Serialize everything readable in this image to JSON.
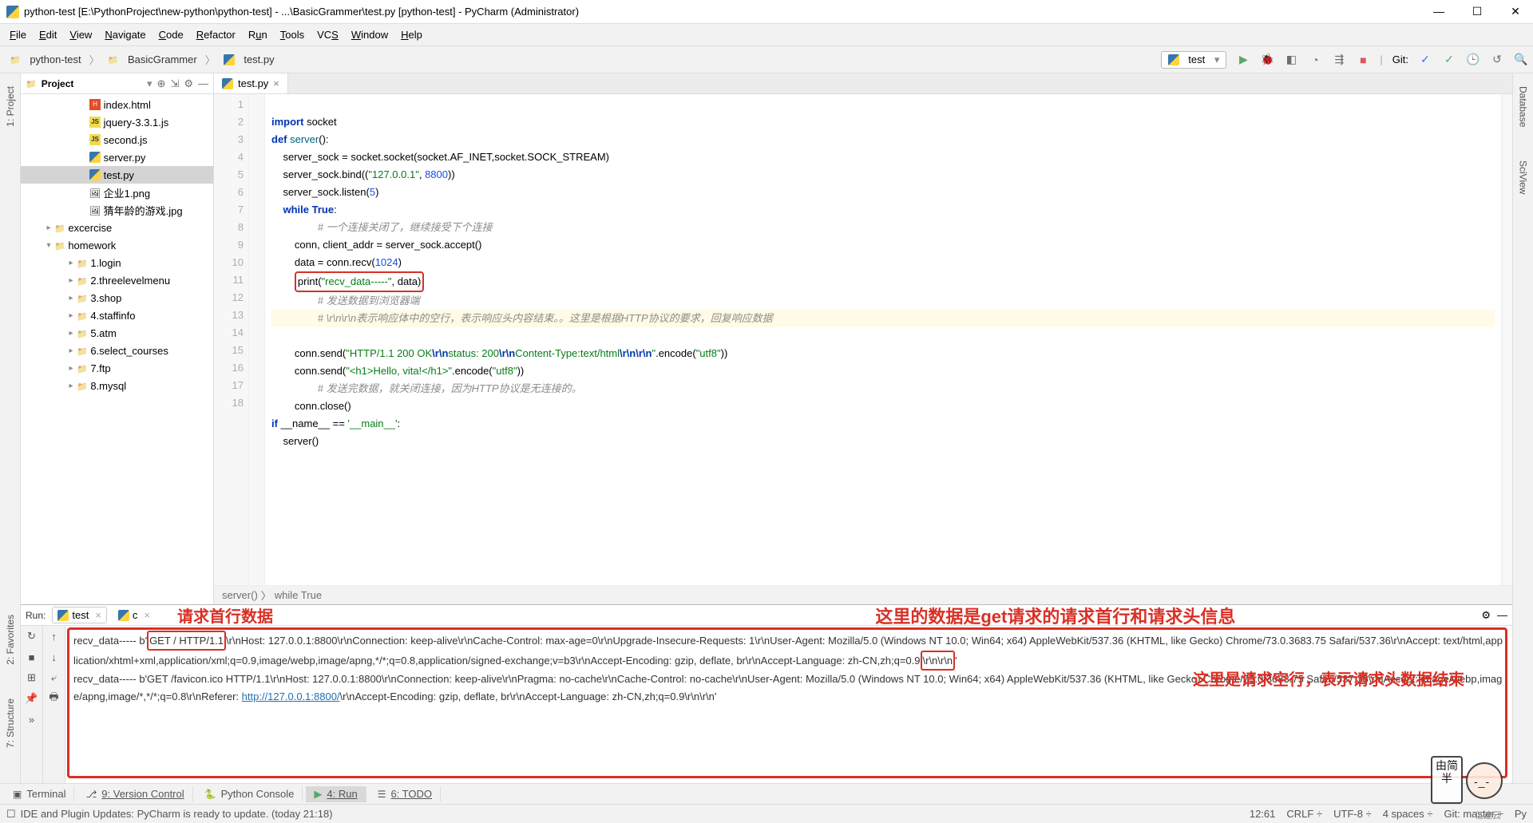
{
  "window": {
    "title": "python-test [E:\\PythonProject\\new-python\\python-test] - ...\\BasicGrammer\\test.py [python-test] - PyCharm (Administrator)"
  },
  "menu": [
    "File",
    "Edit",
    "View",
    "Navigate",
    "Code",
    "Refactor",
    "Run",
    "Tools",
    "VCS",
    "Window",
    "Help"
  ],
  "breadcrumb": {
    "items": [
      "python-test",
      "BasicGrammer",
      "test.py"
    ]
  },
  "run_config": {
    "name": "test"
  },
  "git_label": "Git:",
  "project": {
    "title": "Project",
    "files_flat": [
      {
        "name": "index.html",
        "type": "html",
        "indent": 72
      },
      {
        "name": "jquery-3.3.1.js",
        "type": "js",
        "indent": 72
      },
      {
        "name": "second.js",
        "type": "js",
        "indent": 72
      },
      {
        "name": "server.py",
        "type": "py",
        "indent": 72
      },
      {
        "name": "test.py",
        "type": "py",
        "indent": 72,
        "sel": true
      },
      {
        "name": "企业1.png",
        "type": "img",
        "indent": 72
      },
      {
        "name": "猜年龄的游戏.jpg",
        "type": "img",
        "indent": 72
      }
    ],
    "folders": [
      {
        "name": "excercise",
        "exp": "▸",
        "indent": 28
      },
      {
        "name": "homework",
        "exp": "▾",
        "indent": 28
      },
      {
        "name": "1.login",
        "exp": "▸",
        "indent": 56
      },
      {
        "name": "2.threelevelmenu",
        "exp": "▸",
        "indent": 56
      },
      {
        "name": "3.shop",
        "exp": "▸",
        "indent": 56
      },
      {
        "name": "4.staffinfo",
        "exp": "▸",
        "indent": 56
      },
      {
        "name": "5.atm",
        "exp": "▸",
        "indent": 56
      },
      {
        "name": "6.select_courses",
        "exp": "▸",
        "indent": 56
      },
      {
        "name": "7.ftp",
        "exp": "▸",
        "indent": 56
      },
      {
        "name": "8.mysql",
        "exp": "▸",
        "indent": 56
      }
    ]
  },
  "tab": {
    "name": "test.py"
  },
  "code": {
    "line_count": 18,
    "lines": {
      "l1": "import socket",
      "l2": "def server():",
      "l3": "    server_sock = socket.socket(socket.AF_INET,socket.SOCK_STREAM)",
      "l4_a": "    server_sock.bind((",
      "l4_ip": "\"127.0.0.1\"",
      "l4_b": ", ",
      "l4_port": "8800",
      "l4_c": "))",
      "l5_a": "    server_sock.listen(",
      "l5_n": "5",
      "l5_b": ")",
      "l6": "    while True:",
      "l7": "        # 一个连接关闭了，继续接受下个连接",
      "l8": "        conn, client_addr = server_sock.accept()",
      "l9_a": "        data = conn.recv(",
      "l9_n": "1024",
      "l9_b": ")",
      "l10_a": "        print(",
      "l10_s": "\"recv_data-----\"",
      "l10_b": ", data)",
      "l11": "        # 发送数据到浏览器端",
      "l12": "        # \\r\\n\\r\\n表示响应体中的空行，表示响应头内容结束。。这里是根据HTTP协议的要求，回复响应数据",
      "l13_a": "        conn.send(",
      "l13_s": "\"HTTP/1.1 200 OK\\r\\nstatus: 200\\r\\nContent-Type:text/html\\r\\n\\r\\n\"",
      "l13_b": ".encode(",
      "l13_e": "\"utf8\"",
      "l13_c": "))",
      "l14_a": "        conn.send(",
      "l14_s": "\"<h1>Hello, vita!</h1>\"",
      "l14_b": ".encode(",
      "l14_e": "\"utf8\"",
      "l14_c": "))",
      "l15": "        # 发送完数据，就关闭连接，因为HTTP协议是无连接的。",
      "l16": "        conn.close()",
      "l17_a": "if __name__ == ",
      "l17_s": "'__main__'",
      "l17_b": ":",
      "l18": "    server()"
    },
    "crumb": [
      "server()",
      "while True"
    ]
  },
  "run": {
    "label": "Run:",
    "tabs": [
      "test",
      "c"
    ],
    "out1": "recv_data----- b'GET / HTTP/1.1\\r\\nHost: 127.0.0.1:8800\\r\\nConnection: keep-alive\\r\\nCache-Control: max-age=0\\r\\nUpgrade-Insecure-Requests: 1\\r\\nUser-Agent: Mozilla/5.0 (Windows NT 10.0; Win64; x64) AppleWebKit/537.36 (KHTML, like Gecko) Chrome/73.0.3683.75 Safari/537.36\\r\\nAccept: text/html,application/xhtml+xml,application/xml;q=0.9,image/webp,image/apng,*/*;q=0.8,application/signed-exchange;v=b3\\r\\nAccept-Encoding: gzip, deflate, br\\r\\nAccept-Language: zh-CN,zh;q=0.9\\r\\n\\r\\n'",
    "out2a": "recv_data----- b'GET /favicon.ico HTTP/1.1\\r\\nHost: 127.0.0.1:8800\\r\\nConnection: keep-alive\\r\\nPragma: no-cache\\r\\nCache-Control: no-cache\\r\\nUser-Agent: Mozilla/5.0 (Windows NT 10.0; Win64; x64) AppleWebKit/537.36 (KHTML, like Gecko) Chrome/73.0.3683.75 Safari/537.36\\r\\nAccept: image/webp,image/apng,image/*,*/*;q=0.8\\r\\nReferer: ",
    "out2link": "http://127.0.0.1:8800/",
    "out2b": "\\r\\nAccept-Encoding: gzip, deflate, br\\r\\nAccept-Language: zh-CN,zh;q=0.9\\r\\n\\r\\n'",
    "annot_top": "这里的数据是get请求的请求首行和请求头信息",
    "annot_left": "请求首行数据",
    "annot_right": "这里是请求空行，表示请求头数据结束"
  },
  "bottombar": {
    "terminal": "Terminal",
    "vcs": "9: Version Control",
    "pyconsole": "Python Console",
    "run": "4: Run",
    "todo": "6: TODO"
  },
  "status": {
    "msg": "IDE and Plugin Updates: PyCharm is ready to update. (today 21:18)",
    "pos": "12:61",
    "eol": "CRLF",
    "enc": "UTF-8",
    "indent": "4 spaces",
    "branch": "Git: master",
    "py": "Py"
  },
  "left_tabs": [
    "1: Project",
    "2: Favorites",
    "7: Structure"
  ],
  "right_tabs": [
    "Database",
    "SciView"
  ],
  "sticker": "由简半",
  "watermark": "亿速云"
}
